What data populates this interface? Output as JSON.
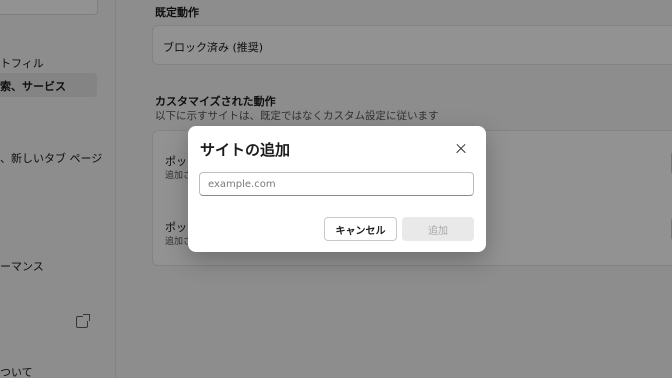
{
  "sidebar": {
    "items": [
      {
        "label": "トフィル"
      },
      {
        "label": "索、サービス"
      },
      {
        "label": "、新しいタブ ページ"
      },
      {
        "label": "ーマンス"
      },
      {
        "label": "ついて"
      }
    ],
    "external_icon": "external-link-icon"
  },
  "main": {
    "default_behavior": {
      "title": "既定動作",
      "value": "ブロック済み (推奨)"
    },
    "custom_behavior": {
      "title": "カスタマイズされた動作",
      "description": "以下に示すサイトは、既定ではなくカスタム設定に従います",
      "rows": [
        {
          "label": "ポッ",
          "sub": "追加さ"
        },
        {
          "label": "ポッ",
          "sub": "追加さ"
        }
      ]
    }
  },
  "dialog": {
    "title": "サイトの追加",
    "close_icon": "close-icon",
    "input": {
      "value": "",
      "placeholder": "example.com"
    },
    "cancel_label": "キャンセル",
    "add_label": "追加"
  },
  "colors": {
    "overlay": "#000000",
    "dialog_bg": "#ffffff",
    "disabled_button_bg": "#e9e9e9"
  }
}
